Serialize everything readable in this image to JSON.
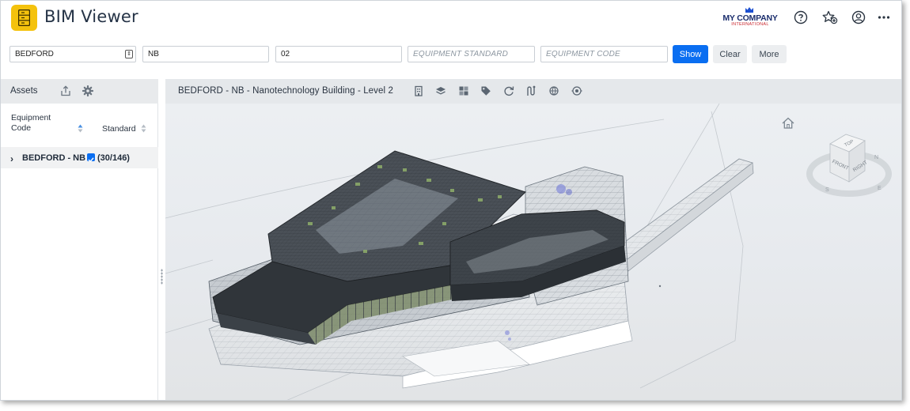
{
  "app": {
    "title": "BIM Viewer"
  },
  "company": {
    "name": "MY COMPANY",
    "subtitle": "INTERNATIONAL"
  },
  "filters": {
    "site": "BEDFORD",
    "building": "NB",
    "level": "02",
    "equipment_standard_placeholder": "EQUIPMENT STANDARD",
    "equipment_code_placeholder": "EQUIPMENT CODE"
  },
  "buttons": {
    "show": "Show",
    "clear": "Clear",
    "more": "More"
  },
  "assets_panel": {
    "title": "Assets",
    "col_code_line1": "Equipment",
    "col_code_line2": "Code",
    "col_standard": "Standard",
    "tree_item": {
      "label": "BEDFORD - NB",
      "count": "(30/146)",
      "checked": true
    }
  },
  "viewer": {
    "title": "BEDFORD - NB - Nanotechnology Building - Level 2",
    "toolbar_icons": [
      "building-icon",
      "layers-icon",
      "grid-icon",
      "tag-icon",
      "refresh-icon",
      "route-icon",
      "network-icon",
      "network-alt-icon"
    ],
    "viewcube": {
      "top": "TOP",
      "front": "FRONT",
      "right": "RIGHT",
      "n": "N",
      "e": "E",
      "s": "S"
    }
  },
  "colors": {
    "accent": "#0a6ef1",
    "app_icon": "#f4c20d",
    "brand_red": "#c8252c",
    "brand_navy": "#1c2f6e"
  }
}
